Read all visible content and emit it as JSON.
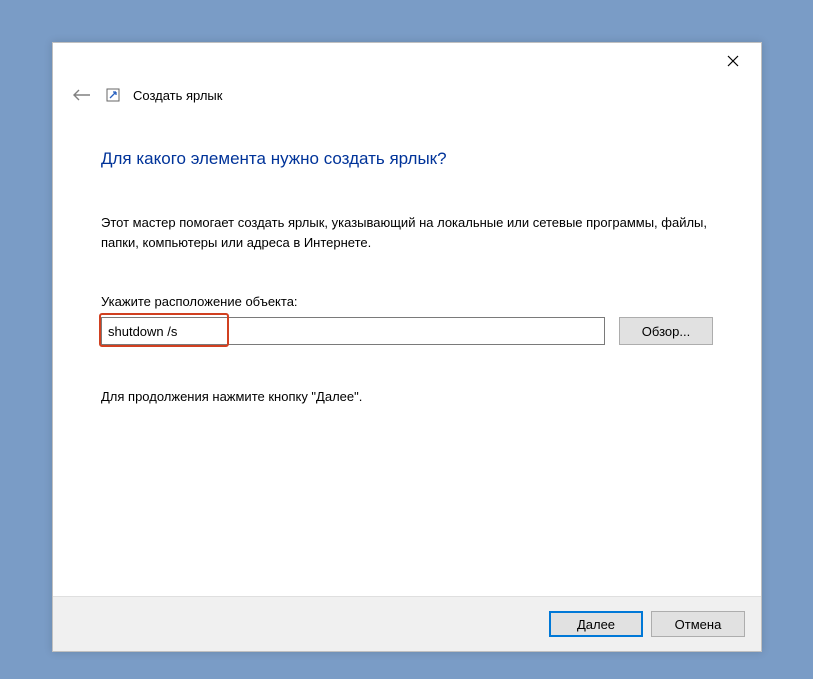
{
  "wizard": {
    "title": "Создать ярлык",
    "heading": "Для какого элемента нужно создать ярлык?",
    "description": "Этот мастер помогает создать ярлык, указывающий на локальные или сетевые программы, файлы, папки, компьютеры или адреса в Интернете.",
    "location_label": "Укажите расположение объекта:",
    "location_value": "shutdown /s",
    "browse_label": "Обзор...",
    "continue_text": "Для продолжения нажмите кнопку \"Далее\".",
    "next_label": "Далее",
    "cancel_label": "Отмена"
  }
}
